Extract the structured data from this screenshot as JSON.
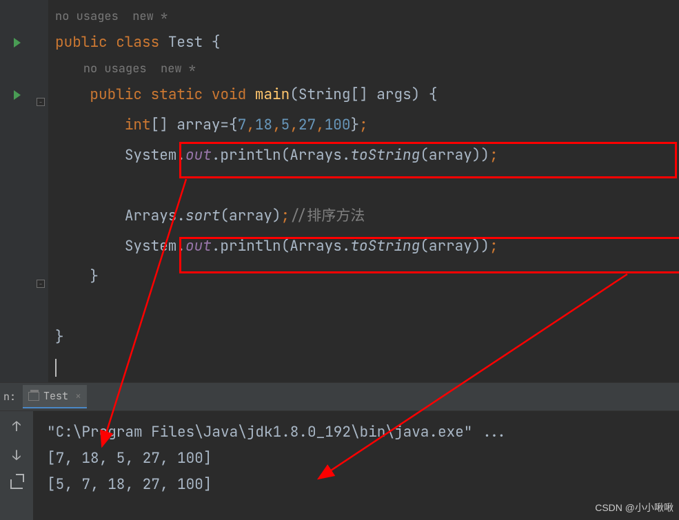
{
  "hints": {
    "class_hint": "no usages  new *",
    "method_hint": "no usages  new *"
  },
  "code": {
    "public": "public",
    "class_kw": "class",
    "class_name": "Test",
    "open_brace": " {",
    "static_kw": "static",
    "void_kw": "void",
    "main": "main",
    "params_open": "(",
    "string_arr": "String[] args",
    "params_close": ")",
    "int_arr": "int",
    "brackets": "[]",
    "array_var": " array=",
    "arr_open": "{",
    "n1": "7",
    "n2": "18",
    "n3": "5",
    "n4": "27",
    "n5": "100",
    "arr_close": "}",
    "semi": ";",
    "system": "System.",
    "out": "out",
    "println": ".println",
    "arrays": "Arrays.",
    "tostring": "toString",
    "array_arg": "(array))",
    "sort": "sort",
    "sort_args": "(array)",
    "sort_comment": "//排序方法",
    "close_brace": "}",
    "comma": ","
  },
  "separator": {
    "run_label": "n:",
    "tab_name": "Test",
    "close": "×"
  },
  "console": {
    "line1": "\"C:\\Program Files\\Java\\jdk1.8.0_192\\bin\\java.exe\" ...",
    "line2": "[7, 18, 5, 27, 100]",
    "line3": "[5, 7, 18, 27, 100]"
  },
  "watermark": "CSDN @小小啾啾"
}
